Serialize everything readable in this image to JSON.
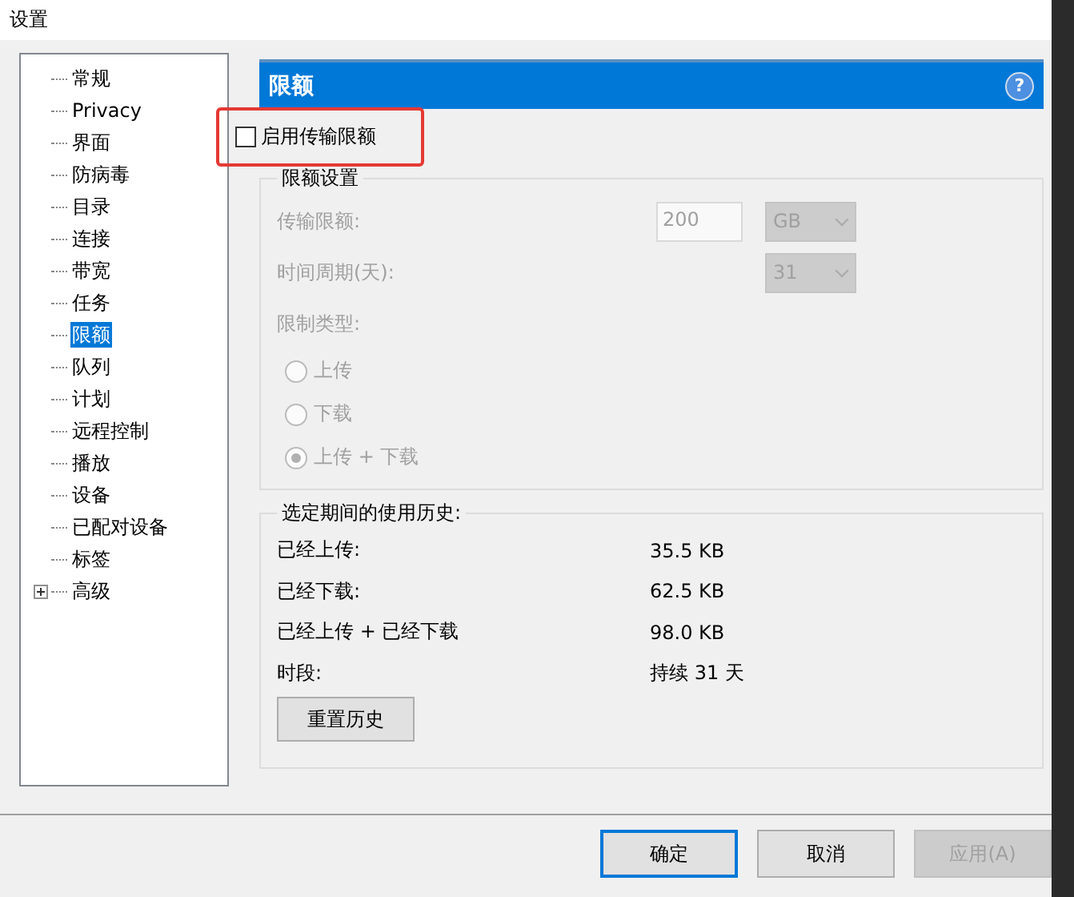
{
  "window": {
    "title": "设置"
  },
  "sidebar": {
    "items": [
      {
        "label": "常规",
        "selected": false
      },
      {
        "label": "Privacy",
        "selected": false
      },
      {
        "label": "界面",
        "selected": false
      },
      {
        "label": "防病毒",
        "selected": false
      },
      {
        "label": "目录",
        "selected": false
      },
      {
        "label": "连接",
        "selected": false
      },
      {
        "label": "带宽",
        "selected": false
      },
      {
        "label": "任务",
        "selected": false
      },
      {
        "label": "限额",
        "selected": true
      },
      {
        "label": "队列",
        "selected": false
      },
      {
        "label": "计划",
        "selected": false
      },
      {
        "label": "远程控制",
        "selected": false
      },
      {
        "label": "播放",
        "selected": false
      },
      {
        "label": "设备",
        "selected": false
      },
      {
        "label": "已配对设备",
        "selected": false
      },
      {
        "label": "标签",
        "selected": false
      },
      {
        "label": "高级",
        "selected": false,
        "expanded": false
      }
    ]
  },
  "header": {
    "title": "限额",
    "help": "?"
  },
  "enable": {
    "label": "启用传输限额",
    "checked": false,
    "highlighted": true
  },
  "limits": {
    "title": "限额设置",
    "disabled": true,
    "amount": {
      "label": "传输限额:",
      "value": "200",
      "unit": "GB"
    },
    "period": {
      "label": "时间周期(天):",
      "value": "31"
    },
    "type_label": "限制类型:",
    "types": [
      {
        "label": "上传",
        "selected": false
      },
      {
        "label": "下载",
        "selected": false
      },
      {
        "label": "上传 + 下载",
        "selected": true
      }
    ]
  },
  "history": {
    "title": "选定期间的使用历史:",
    "rows": [
      {
        "label": "已经上传:",
        "value": "35.5 KB"
      },
      {
        "label": "已经下载:",
        "value": "62.5 KB"
      },
      {
        "label": "已经上传 + 已经下载",
        "value": "98.0 KB"
      },
      {
        "label": "时段:",
        "value": "持续 31 天"
      }
    ],
    "reset": "重置历史"
  },
  "buttons": [
    {
      "label": "确定",
      "kind": "default",
      "disabled": false
    },
    {
      "label": "取消",
      "kind": "normal",
      "disabled": false
    },
    {
      "label": "应用(A)",
      "kind": "normal",
      "disabled": true
    }
  ]
}
